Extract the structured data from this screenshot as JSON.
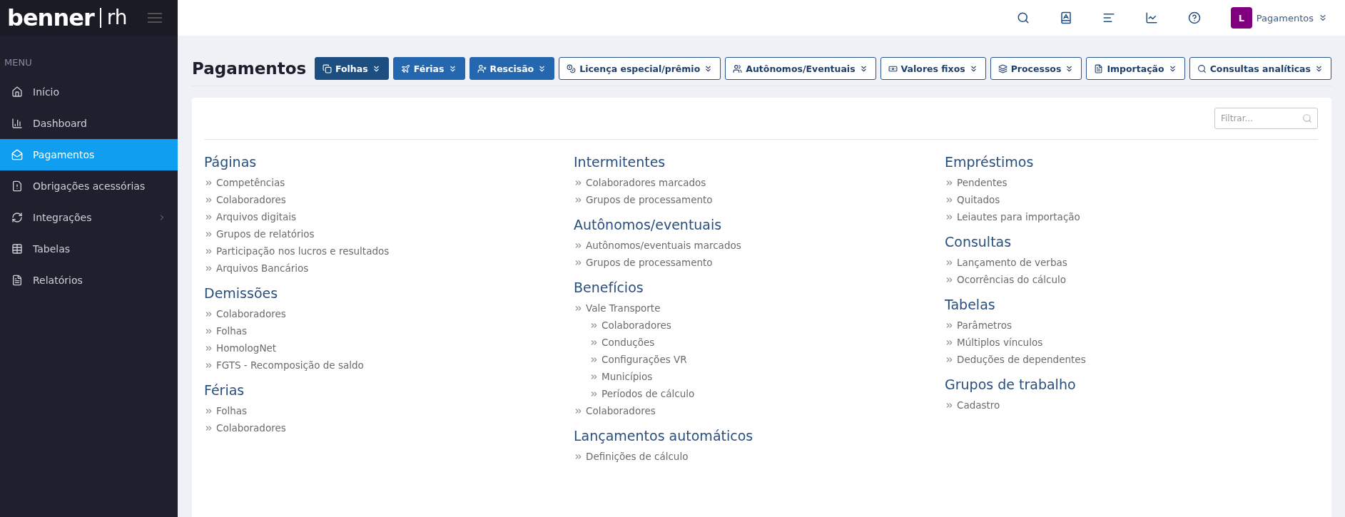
{
  "brand": {
    "name": "benner",
    "product": "rh"
  },
  "topbar": {
    "user_initial": "L",
    "context": "Pagamentos"
  },
  "sidebar": {
    "heading": "MENU",
    "items": [
      {
        "label": "Início",
        "selected": false,
        "submenu": false
      },
      {
        "label": "Dashboard",
        "selected": false,
        "submenu": false
      },
      {
        "label": "Pagamentos",
        "selected": true,
        "submenu": false
      },
      {
        "label": "Obrigações acessórias",
        "selected": false,
        "submenu": false
      },
      {
        "label": "Integrações",
        "selected": false,
        "submenu": true
      },
      {
        "label": "Tabelas",
        "selected": false,
        "submenu": false
      },
      {
        "label": "Relatórios",
        "selected": false,
        "submenu": false
      }
    ]
  },
  "page": {
    "title": "Pagamentos",
    "buttons": [
      {
        "label": "Folhas",
        "kind": "dark"
      },
      {
        "label": "Férias",
        "kind": "filled"
      },
      {
        "label": "Rescisão",
        "kind": "filled"
      },
      {
        "label": "Licença especial/prêmio",
        "kind": "outline"
      },
      {
        "label": "Autônomos/Eventuais",
        "kind": "outline"
      },
      {
        "label": "Valores fixos",
        "kind": "outline"
      },
      {
        "label": "Processos",
        "kind": "outline"
      },
      {
        "label": "Importação",
        "kind": "outline"
      },
      {
        "label": "Consultas analíticas",
        "kind": "outline"
      }
    ]
  },
  "filter": {
    "placeholder": "Filtrar..."
  },
  "columns": [
    [
      {
        "title": "Páginas",
        "items": [
          {
            "label": "Competências"
          },
          {
            "label": "Colaboradores"
          },
          {
            "label": "Arquivos digitais"
          },
          {
            "label": "Grupos de relatórios"
          },
          {
            "label": "Participação nos lucros e resultados"
          },
          {
            "label": "Arquivos Bancários"
          }
        ]
      },
      {
        "title": "Demissões",
        "items": [
          {
            "label": "Colaboradores"
          },
          {
            "label": "Folhas"
          },
          {
            "label": "HomologNet"
          },
          {
            "label": "FGTS - Recomposição de saldo"
          }
        ]
      },
      {
        "title": "Férias",
        "items": [
          {
            "label": "Folhas"
          },
          {
            "label": "Colaboradores"
          }
        ]
      }
    ],
    [
      {
        "title": "Intermitentes",
        "items": [
          {
            "label": "Colaboradores marcados"
          },
          {
            "label": "Grupos de processamento"
          }
        ]
      },
      {
        "title": "Autônomos/eventuais",
        "items": [
          {
            "label": "Autônomos/eventuais marcados"
          },
          {
            "label": "Grupos de processamento"
          }
        ]
      },
      {
        "title": "Benefícios",
        "items": [
          {
            "label": "Vale Transporte",
            "children": [
              {
                "label": "Colaboradores"
              },
              {
                "label": "Conduções"
              },
              {
                "label": "Configurações VR"
              },
              {
                "label": "Municípios"
              },
              {
                "label": "Períodos de cálculo"
              }
            ]
          },
          {
            "label": "Colaboradores"
          }
        ]
      },
      {
        "title": "Lançamentos automáticos",
        "items": [
          {
            "label": "Definições de cálculo"
          }
        ]
      }
    ],
    [
      {
        "title": "Empréstimos",
        "items": [
          {
            "label": "Pendentes"
          },
          {
            "label": "Quitados"
          },
          {
            "label": "Leiautes para importação"
          }
        ]
      },
      {
        "title": "Consultas",
        "items": [
          {
            "label": "Lançamento de verbas"
          },
          {
            "label": "Ocorrências do cálculo"
          }
        ]
      },
      {
        "title": "Tabelas",
        "items": [
          {
            "label": "Parâmetros"
          },
          {
            "label": "Múltiplos vínculos"
          },
          {
            "label": "Deduções de dependentes"
          }
        ]
      },
      {
        "title": "Grupos de trabalho",
        "items": [
          {
            "label": "Cadastro"
          }
        ]
      }
    ]
  ]
}
